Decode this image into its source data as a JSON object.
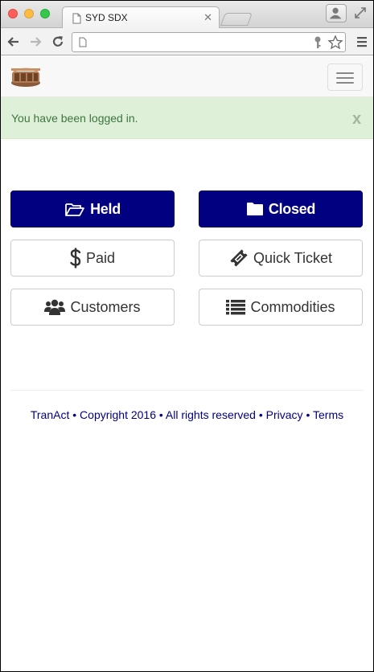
{
  "browser": {
    "tab_title": "SYD SDX",
    "tab_close": "✕"
  },
  "alert": {
    "message": "You have been logged in.",
    "close_label": "x"
  },
  "buttons": {
    "held": "Held",
    "closed": "Closed",
    "paid": "Paid",
    "quick_ticket": "Quick Ticket",
    "customers": "Customers",
    "commodities": "Commodities"
  },
  "footer": {
    "brand": "TranAct",
    "sep": " • ",
    "copyright": "Copyright 2016",
    "rights": "All rights reserved",
    "privacy": "Privacy",
    "terms": "Terms"
  },
  "colors": {
    "primary": "#000080",
    "alert_bg": "#dff0d8",
    "alert_text": "#3c763d"
  }
}
